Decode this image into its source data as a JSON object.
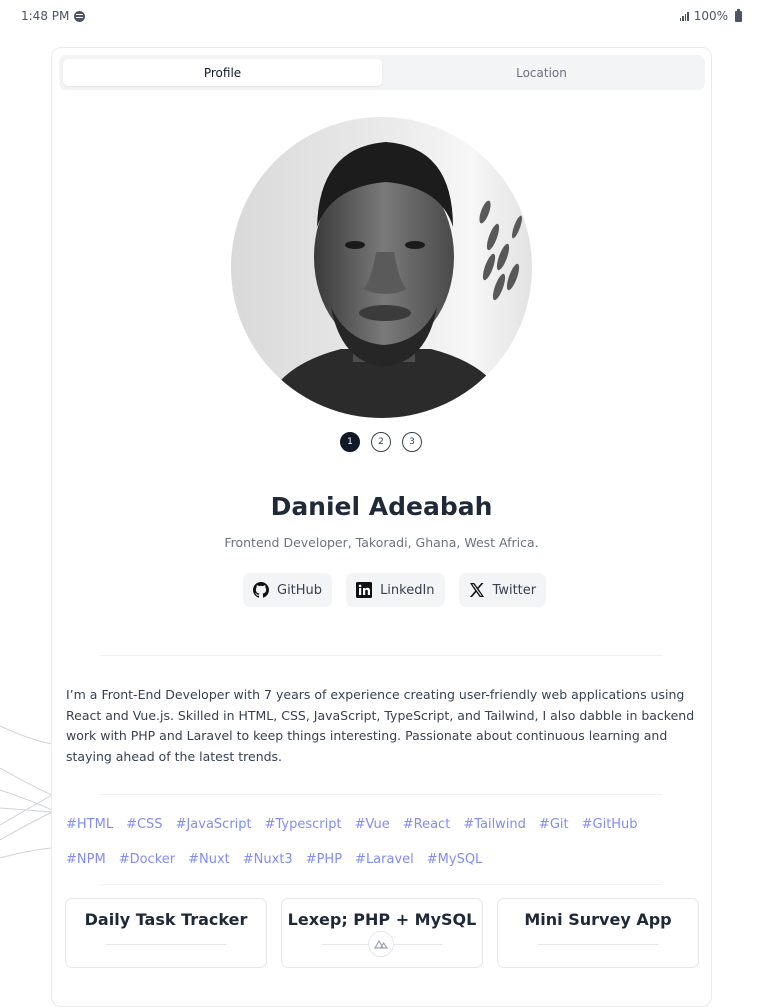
{
  "status_bar": {
    "time": "1:48 PM",
    "battery": "100%",
    "icons": [
      "spotify-icon",
      "signal-icon",
      "battery-icon"
    ]
  },
  "tabs": [
    {
      "label": "Profile",
      "active": true
    },
    {
      "label": "Location",
      "active": false
    }
  ],
  "carousel": {
    "pages": [
      "1",
      "2",
      "3"
    ],
    "active_page": "1"
  },
  "profile": {
    "name": "Daniel Adeabah",
    "subtitle": "Frontend Developer, Takoradi, Ghana, West Africa.",
    "bio": "I’m a Front-End Developer with 7 years of experience creating user-friendly web applications using React and Vue.js. Skilled in HTML, CSS, JavaScript, TypeScript, and Tailwind, I also dabble in backend work with PHP and Laravel to keep things interesting. Passionate about continuous learning and staying ahead of the latest trends."
  },
  "socials": [
    {
      "label": "GitHub",
      "icon": "github-icon"
    },
    {
      "label": "LinkedIn",
      "icon": "linkedin-icon"
    },
    {
      "label": "Twitter",
      "icon": "x-icon"
    }
  ],
  "tags": [
    "#HTML",
    "#CSS",
    "#JavaScript",
    "#Typescript",
    "#Vue",
    "#React",
    "#Tailwind",
    "#Git",
    "#GitHub",
    "#NPM",
    "#Docker",
    "#Nuxt",
    "#Nuxt3",
    "#PHP",
    "#Laravel",
    "#MySQL"
  ],
  "projects": [
    {
      "title": "Daily Task Tracker"
    },
    {
      "title": "Lexep; PHP + MySQL"
    },
    {
      "title": "Mini Survey App"
    }
  ],
  "colors": {
    "accent_tag": "#818cf8",
    "text_dark": "#1f2937",
    "tab_bg": "#f3f4f6"
  }
}
